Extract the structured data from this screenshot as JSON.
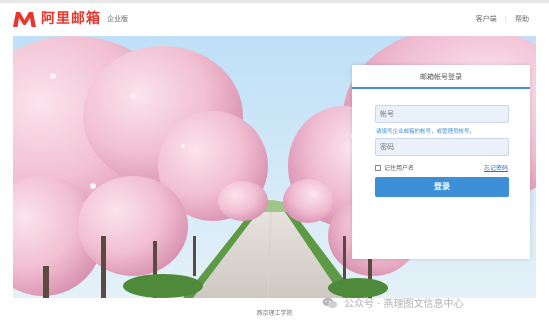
{
  "header": {
    "logo_name": "阿里邮箱",
    "logo_edition": "企业版",
    "links": [
      "客户端",
      "帮助"
    ],
    "brand_color": "#e8362d"
  },
  "login": {
    "title": "邮箱帐号登录",
    "account_placeholder": "帐号",
    "hint": "请填写企业邮箱的帐号，或管理员帐号。",
    "password_placeholder": "密码",
    "remember_label": "记住用户名",
    "forgot_label": "忘记密码",
    "submit_label": "登录",
    "accent_color": "#3d8fd8"
  },
  "footer": {
    "org_name": "燕京理工学院"
  },
  "watermark": {
    "text": "公众号 · 燕理图文信息中心"
  }
}
